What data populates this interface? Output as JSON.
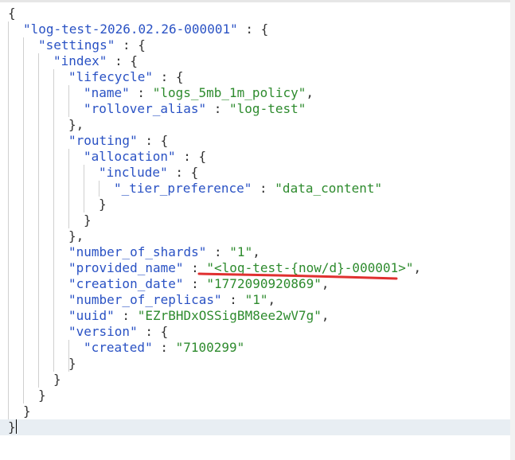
{
  "json_view": {
    "index_name": "\"log-test-2026.02.26-000001\"",
    "key_settings": "\"settings\"",
    "key_index": "\"index\"",
    "key_lifecycle": "\"lifecycle\"",
    "key_name": "\"name\"",
    "val_name": "\"logs_5mb_1m_policy\"",
    "key_rollover_alias": "\"rollover_alias\"",
    "val_rollover_alias": "\"log-test\"",
    "key_routing": "\"routing\"",
    "key_allocation": "\"allocation\"",
    "key_include": "\"include\"",
    "key_tier_preference": "\"_tier_preference\"",
    "val_tier_preference": "\"data_content\"",
    "key_number_of_shards": "\"number_of_shards\"",
    "val_number_of_shards": "\"1\"",
    "key_provided_name": "\"provided_name\"",
    "val_provided_name": "\"<log-test-{now/d}-000001>\"",
    "key_creation_date": "\"creation_date\"",
    "val_creation_date": "\"1772090920869\"",
    "key_number_of_replicas": "\"number_of_replicas\"",
    "val_number_of_replicas": "\"1\"",
    "key_uuid": "\"uuid\"",
    "val_uuid": "\"EZrBHDxOSSigBM8ee2wV7g\"",
    "key_version": "\"version\"",
    "key_created": "\"created\"",
    "val_created": "\"7100299\""
  },
  "colors": {
    "key": "#2a52c4",
    "string": "#2e8b2e",
    "punctuation": "#333333",
    "annotation": "#e03030",
    "active_line": "#e8eef3"
  }
}
